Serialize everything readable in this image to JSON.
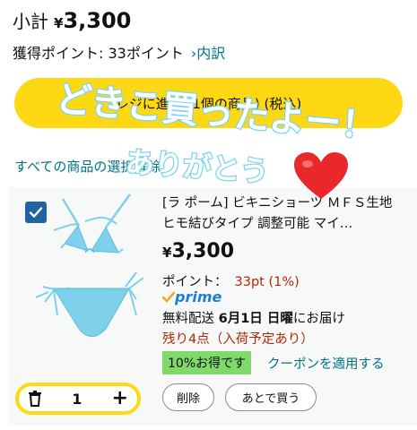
{
  "cart": {
    "subtotal_label": "小計",
    "currency_symbol": "¥",
    "subtotal_amount": "3,300",
    "points_text": "獲得ポイント: 33ポイント",
    "points_link": "›内訳",
    "checkout_button": "レジに進む (1個の商品) (税込)",
    "all_items_link": "すべての商品の選択解除"
  },
  "item": {
    "title": "[ラ ポーム] ビキニショーツ ＭＦＳ生地 ヒモ結びタイプ 調整可能 マイ…",
    "price_symbol": "¥",
    "price": "3,300",
    "points_label": "ポイント：",
    "points_value": "33pt (1%)",
    "prime_label": "prime",
    "delivery_prefix": "無料配送",
    "delivery_date": "6月1日 日曜",
    "delivery_suffix": "にお届け",
    "stock": "残り4点（入荷予定あり）",
    "deal_badge": "10%お得です",
    "coupon_link": "クーポンを適用する",
    "quantity": "1",
    "delete_button": "削除",
    "save_later_button": "あとで買う"
  },
  "overlay": {
    "line1": "どきこ買ったよー！",
    "line2": "ありがとう",
    "heart_icon": "heart-icon",
    "text_color": "#ffffff",
    "outline_color": "#7dd3f0",
    "heart_color": "#e8282b"
  },
  "colors": {
    "checkout_yellow": "#ffd814",
    "link_teal": "#007185",
    "price_red": "#b12704",
    "checkbox_blue": "#2162a1",
    "deal_green": "#7fda69",
    "prime_blue": "#1c7ed6",
    "product_blue": "#7fd0ea"
  }
}
